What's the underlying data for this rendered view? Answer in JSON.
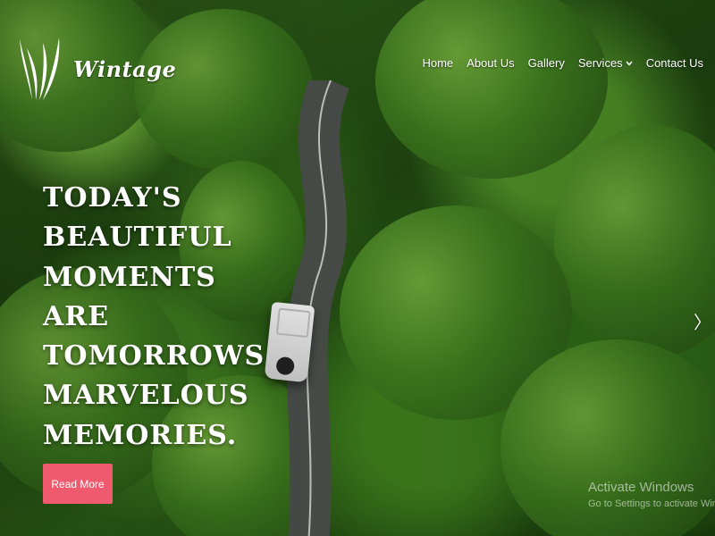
{
  "brand": {
    "name": "Wintage"
  },
  "nav": {
    "items": [
      {
        "label": "Home"
      },
      {
        "label": "About Us"
      },
      {
        "label": "Gallery"
      },
      {
        "label": "Services",
        "has_dropdown": true
      },
      {
        "label": "Contact Us"
      }
    ]
  },
  "hero": {
    "headline_lines": [
      "TODAY'S",
      "BEAUTIFUL",
      "MOMENTS ARE",
      "TOMORROWS",
      "MARVELOUS",
      "MEMORIES."
    ],
    "cta_label": "Read More",
    "next_arrow": "〉"
  },
  "watermark": {
    "title": "Activate Windows",
    "subtitle": "Go to Settings to activate Windows."
  },
  "colors": {
    "cta": "#f05a6e",
    "text": "#ffffff",
    "foliage_dark": "#1e4510",
    "foliage_light": "#6fae3a"
  },
  "icons": [
    "logo-mark-icon",
    "chevron-down-icon",
    "chevron-right-icon"
  ]
}
